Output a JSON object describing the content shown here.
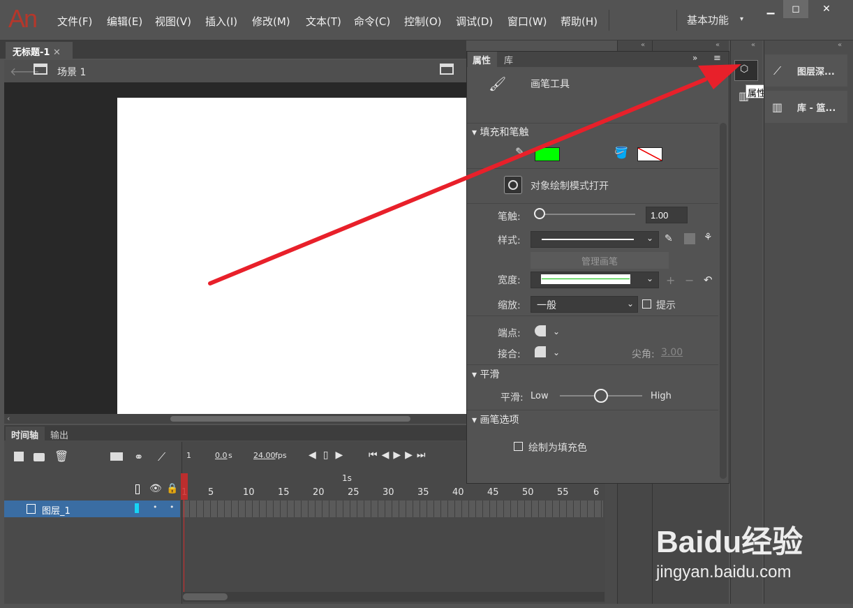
{
  "app": {
    "logo": "An"
  },
  "menu": [
    "文件(F)",
    "编辑(E)",
    "视图(V)",
    "插入(I)",
    "修改(M)",
    "文本(T)",
    "命令(C)",
    "控制(O)",
    "调试(D)",
    "窗口(W)",
    "帮助(H)"
  ],
  "workspace": "基本功能",
  "document": {
    "tab_title": "无标题-1",
    "scene": "场景 1"
  },
  "timeline": {
    "tabs": [
      "时间轴",
      "输出"
    ],
    "current_frame": "1",
    "time": "0.0",
    "time_unit": "s",
    "fps": "24.00",
    "fps_unit": "fps",
    "second_marker": "1s",
    "ruler": [
      "1",
      "5",
      "10",
      "15",
      "20",
      "25",
      "30",
      "35",
      "40",
      "45",
      "50",
      "55",
      "6"
    ],
    "layer_name": "图层_1"
  },
  "properties": {
    "tabs": [
      "属性",
      "库"
    ],
    "tool_name": "画笔工具",
    "section_fill": "填充和笔触",
    "object_draw": "对象绘制模式打开",
    "stroke_label": "笔触:",
    "stroke_value": "1.00",
    "style_label": "样式:",
    "manage_brush": "管理画笔",
    "width_label": "宽度:",
    "scale_label": "缩放:",
    "scale_value": "一般",
    "hint_label": "提示",
    "cap_label": "端点:",
    "join_label": "接合:",
    "miter_label": "尖角:",
    "miter_value": "3.00",
    "section_smooth": "平滑",
    "smooth_label": "平滑:",
    "smooth_low": "Low",
    "smooth_high": "High",
    "smooth_level": 0.5,
    "section_brush": "画笔选项",
    "draw_as_fill": "绘制为填充色",
    "stroke_color": "#00ff00"
  },
  "right_panels": [
    {
      "label": "图层深..."
    },
    {
      "label": "库 - 篮..."
    }
  ],
  "tooltip": "属性",
  "watermark": {
    "brand": "Baidu经验",
    "url": "jingyan.baidu.com"
  }
}
